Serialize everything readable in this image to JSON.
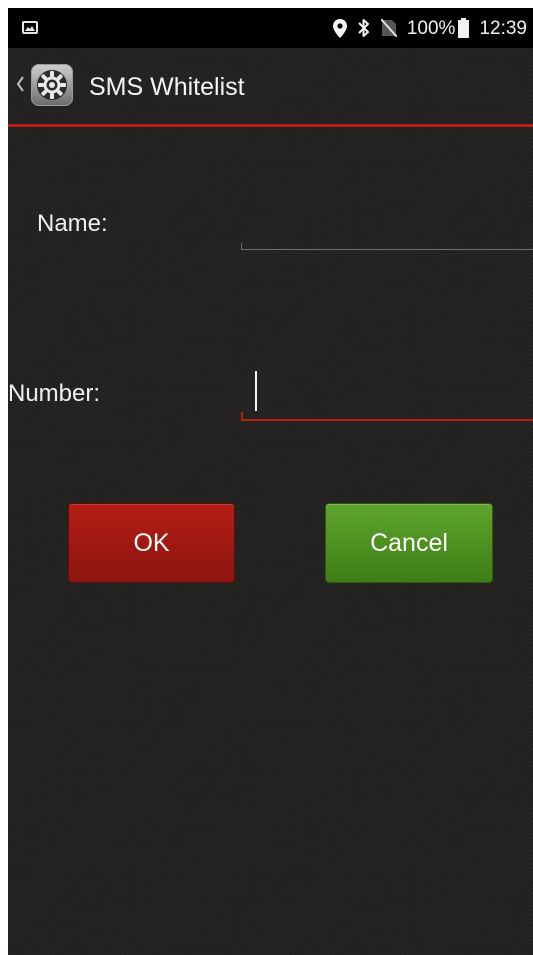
{
  "status_bar": {
    "battery": "100%",
    "time": "12:39",
    "icons": [
      "gallery-icon",
      "location-icon",
      "bluetooth-icon",
      "no-sim-icon",
      "battery-icon"
    ]
  },
  "action_bar": {
    "title": "SMS Whitelist",
    "icons": [
      "back-chevron-icon",
      "settings-gear-icon"
    ]
  },
  "form": {
    "name_label": "Name:",
    "name_value": "",
    "number_label": "Number:",
    "number_value": ""
  },
  "buttons": {
    "ok": "OK",
    "cancel": "Cancel"
  },
  "colors": {
    "accent_red": "#b81d18",
    "ok_button": "#a81a14",
    "cancel_button": "#4f9223",
    "background": "#242322"
  }
}
